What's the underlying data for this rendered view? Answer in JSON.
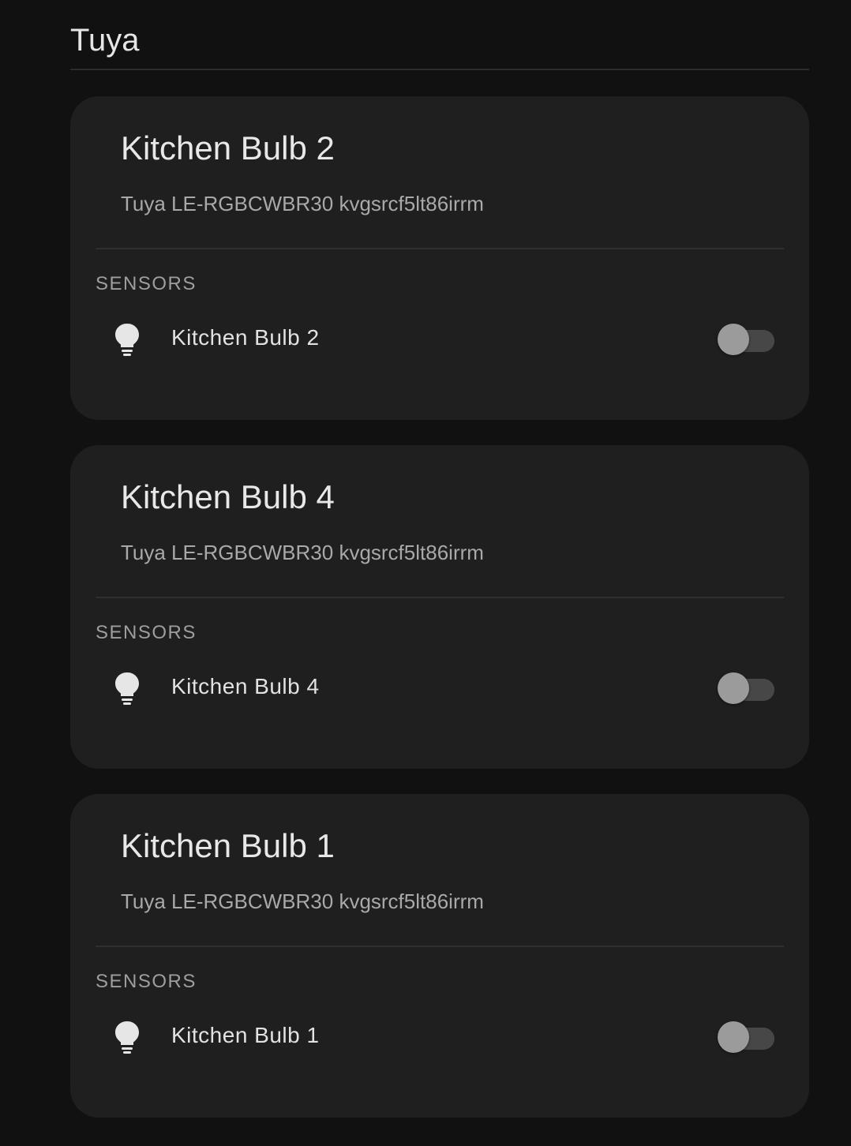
{
  "section": {
    "title": "Tuya"
  },
  "devices": [
    {
      "title": "Kitchen Bulb 2",
      "subtitle": "Tuya LE-RGBCWBR30 kvgsrcf5lt86irrm",
      "group_label": "SENSORS",
      "entity": {
        "icon": "lightbulb-icon",
        "name": "Kitchen Bulb 2",
        "state": "off"
      }
    },
    {
      "title": "Kitchen Bulb 4",
      "subtitle": "Tuya LE-RGBCWBR30 kvgsrcf5lt86irrm",
      "group_label": "SENSORS",
      "entity": {
        "icon": "lightbulb-icon",
        "name": "Kitchen Bulb 4",
        "state": "off"
      }
    },
    {
      "title": "Kitchen Bulb 1",
      "subtitle": "Tuya LE-RGBCWBR30 kvgsrcf5lt86irrm",
      "group_label": "SENSORS",
      "entity": {
        "icon": "lightbulb-icon",
        "name": "Kitchen Bulb 1",
        "state": "off"
      }
    }
  ],
  "colors": {
    "background": "#111111",
    "card": "#1f1f1f",
    "toggle_track_off": "#474747",
    "toggle_thumb_off": "#9b9b9b"
  }
}
